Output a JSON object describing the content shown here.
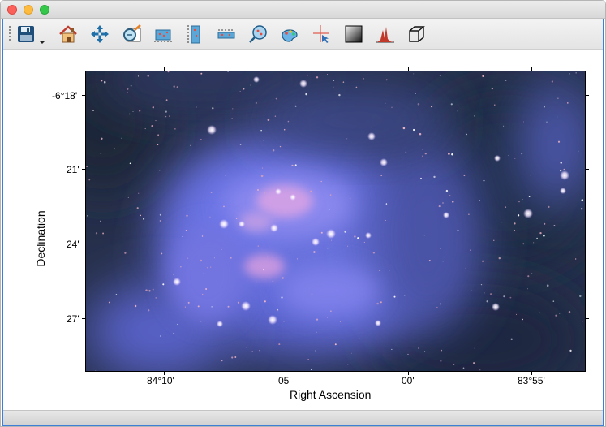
{
  "window": {
    "title": "",
    "controls": [
      "close-button",
      "minimize-button",
      "zoom-button"
    ]
  },
  "toolbar": {
    "tools": [
      {
        "name": "save-icon",
        "has_dropdown": true
      },
      {
        "name": "home-icon"
      },
      {
        "name": "pan-icon"
      },
      {
        "name": "zoom-icon"
      },
      {
        "name": "horizontal-scale-icon"
      },
      {
        "name": "vertical-scale-icon"
      },
      {
        "name": "contrast-icon"
      },
      {
        "name": "star-target-icon"
      },
      {
        "name": "colormap-icon"
      },
      {
        "name": "crosshair-icon"
      },
      {
        "name": "grayscale-icon"
      },
      {
        "name": "histogram-icon"
      },
      {
        "name": "cube-icon"
      }
    ]
  },
  "plot": {
    "xlabel": "Right Ascension",
    "ylabel": "Declination",
    "x_ticks": [
      "84°10'",
      "05'",
      "00'",
      "83°55'"
    ],
    "y_ticks": [
      "-6°18'",
      "21'",
      "24'",
      "27'"
    ],
    "image_description_colors": {
      "background_dark": "#1e2a40",
      "nebula_blue": "#6a73e0",
      "nebula_pink": "#d49ad8"
    }
  }
}
